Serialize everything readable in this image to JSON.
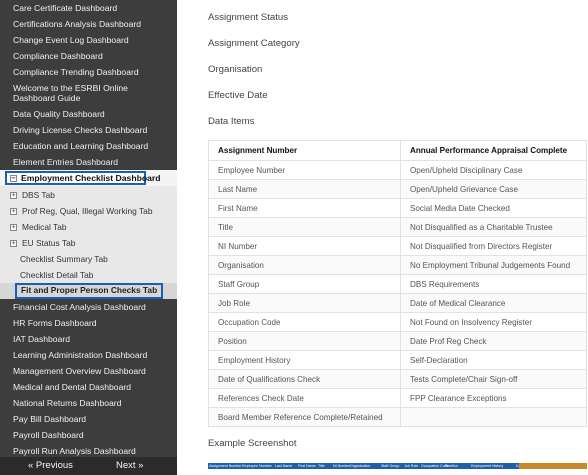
{
  "sidebar": {
    "items_top": [
      {
        "label": "Care Certificate Dashboard"
      },
      {
        "label": "Certifications Analysis Dashboard"
      },
      {
        "label": "Change Event Log Dashboard"
      },
      {
        "label": "Compliance Dashboard"
      },
      {
        "label": "Compliance Trending Dashboard"
      },
      {
        "label": "Welcome to the ESRBI Online Dashboard Guide"
      },
      {
        "label": "Data Quality Dashboard"
      },
      {
        "label": "Driving License Checks Dashboard"
      },
      {
        "label": "Education and Learning Dashboard"
      },
      {
        "label": "Element Entries Dashboard"
      }
    ],
    "expanded": {
      "toggle": "⊟",
      "label": "Employment Checklist Dashboard"
    },
    "sub_items": [
      {
        "label": "DBS Tab",
        "toggle": "+"
      },
      {
        "label": "Prof Reg, Qual, Illegal Working Tab",
        "toggle": "+"
      },
      {
        "label": "Medical Tab",
        "toggle": "+"
      },
      {
        "label": "EU Status Tab",
        "toggle": "+"
      },
      {
        "label": "Checklist Summary Tab",
        "toggle": ""
      },
      {
        "label": "Checklist Detail Tab",
        "toggle": ""
      }
    ],
    "selected": {
      "label": "Fit and Proper Person Checks Tab"
    },
    "items_bottom": [
      {
        "label": "Financial Cost Analysis Dashboard"
      },
      {
        "label": "HR Forms Dashboard"
      },
      {
        "label": "IAT Dashboard"
      },
      {
        "label": "Learning Administration Dashboard"
      },
      {
        "label": "Management Overview Dashboard"
      },
      {
        "label": "Medical and Dental Dashboard"
      },
      {
        "label": "National Returns Dashboard"
      },
      {
        "label": "Pay Bill Dashboard"
      },
      {
        "label": "Payroll Dashboard"
      },
      {
        "label": "Payroll Run Analysis Dashboard"
      }
    ],
    "pager": {
      "previous": "« Previous",
      "next": "Next »"
    }
  },
  "main": {
    "headings": {
      "assignment_status": "Assignment Status",
      "assignment_category": "Assignment Category",
      "organisation": "Organisation",
      "effective_date": "Effective Date",
      "data_items": "Data Items",
      "example_screenshot": "Example Screenshot"
    },
    "table": {
      "headers": [
        "Assignment Number",
        "Annual Performance Appraisal Complete"
      ],
      "rows": [
        [
          "Employee Number",
          "Open/Upheld Disciplinary Case"
        ],
        [
          "Last Name",
          "Open/Upheld Grievance Case"
        ],
        [
          "First Name",
          "Social Media Date Checked"
        ],
        [
          "Title",
          "Not Disqualified as a Charitable Trustee"
        ],
        [
          "NI Number",
          "Not Disqualified from Directors Register"
        ],
        [
          "Organisation",
          "No Employment Tribunal Judgements Found"
        ],
        [
          "Staff Group",
          "DBS Requirements"
        ],
        [
          "Job Role",
          "Date of Medical Clearance"
        ],
        [
          "Occupation Code",
          "Not Found on Insolvency Register"
        ],
        [
          "Position",
          "Date Prof Reg Check"
        ],
        [
          "Employment History",
          "Self-Declaration"
        ],
        [
          "Date of Qualifications Check",
          "Tests Complete/Chair Sign-off"
        ],
        [
          "References Check Date",
          "FPP Clearance Exceptions"
        ],
        [
          "Board Member Reference Complete/Retained",
          ""
        ]
      ]
    },
    "example_strip": {
      "labels": [
        "Assignment Number",
        "Employee Number",
        "Last Name",
        "First Name",
        "Title",
        "NI Number",
        "Organisation",
        "Staff Group",
        "Job Role",
        "Occupation Code",
        "Position",
        "Employment History",
        "Date of Qualifications Check"
      ]
    }
  },
  "colors": {
    "sidebar_bg": "#3d3d3d",
    "highlight_border": "#1a5fb4",
    "example_header": "#1f5fa8"
  }
}
